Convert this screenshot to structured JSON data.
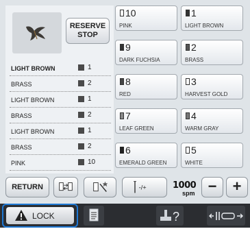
{
  "reserve": {
    "line1": "RESERVE",
    "line2": "STOP"
  },
  "threads": [
    {
      "name": "LIGHT BROWN",
      "num": "1",
      "current": true
    },
    {
      "name": "BRASS",
      "num": "2"
    },
    {
      "name": "LIGHT BROWN",
      "num": "1"
    },
    {
      "name": "BRASS",
      "num": "2"
    },
    {
      "name": "LIGHT BROWN",
      "num": "1"
    },
    {
      "name": "BRASS",
      "num": "2"
    },
    {
      "name": "PINK",
      "num": "10"
    }
  ],
  "spools": [
    {
      "num": "10",
      "label": "PINK"
    },
    {
      "num": "1",
      "label": "LIGHT BROWN"
    },
    {
      "num": "9",
      "label": "DARK FUCHSIA"
    },
    {
      "num": "2",
      "label": "BRASS"
    },
    {
      "num": "8",
      "label": "RED"
    },
    {
      "num": "3",
      "label": "HARVEST GOLD"
    },
    {
      "num": "7",
      "label": "LEAF GREEN"
    },
    {
      "num": "4",
      "label": "WARM GRAY"
    },
    {
      "num": "6",
      "label": "EMERALD GREEN"
    },
    {
      "num": "5",
      "label": "WHITE"
    }
  ],
  "toolbar": {
    "return_label": "RETURN",
    "speed_value": "1000",
    "speed_unit": "spm",
    "minus": "−",
    "plus": "+"
  },
  "bottom_bar": {
    "lock_label": "LOCK"
  },
  "colors": {
    "accent_blue": "#1e78d4",
    "bar_bg": "#2b2d31"
  }
}
